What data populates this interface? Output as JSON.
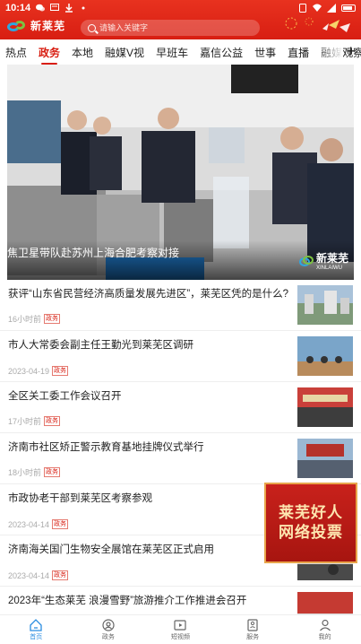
{
  "status_bar": {
    "time": "10:14"
  },
  "header": {
    "logo_text": "新莱芜",
    "search_placeholder": "请输入关键字"
  },
  "tabs": {
    "items": [
      {
        "label": "热点"
      },
      {
        "label": "政务"
      },
      {
        "label": "本地"
      },
      {
        "label": "融媒V视"
      },
      {
        "label": "早班车"
      },
      {
        "label": "嘉信公益"
      },
      {
        "label": "世事"
      },
      {
        "label": "直播"
      },
      {
        "label": "融媒观察"
      }
    ],
    "plus": "+"
  },
  "hero": {
    "title": "焦卫星带队赴苏州上海合肥考察对接",
    "logo_text": "新莱芜",
    "logo_sub": "XINLAIWU"
  },
  "news": [
    {
      "title": "获评“山东省民营经济高质量发展先进区”，莱芜区凭的是什么?",
      "time": "16小时前",
      "tag": "政务"
    },
    {
      "title": "市人大常委会副主任王勤光到莱芜区调研",
      "time": "2023-04-19",
      "tag": "政务"
    },
    {
      "title": "全区关工委工作会议召开",
      "time": "17小时前",
      "tag": "政务"
    },
    {
      "title": "济南市社区矫正警示教育基地挂牌仪式举行",
      "time": "18小时前",
      "tag": "政务"
    },
    {
      "title": "市政协老干部到莱芜区考察参观",
      "time": "2023-04-14",
      "tag": "政务"
    },
    {
      "title": "济南海关国门生物安全展馆在莱芜区正式启用",
      "time": "2023-04-14",
      "tag": "政务"
    },
    {
      "title": "2023年“生态莱芜 浪漫雪野”旅游推介工作推进会召开",
      "time": "",
      "tag": ""
    }
  ],
  "vote_banner": {
    "line1": "莱芜好人",
    "line2": "网络投票"
  },
  "bottom_nav": [
    {
      "label": "首页",
      "icon": "home-icon"
    },
    {
      "label": "政务",
      "icon": "user-icon"
    },
    {
      "label": "短视频",
      "icon": "video-icon"
    },
    {
      "label": "服务",
      "icon": "service-icon"
    },
    {
      "label": "我的",
      "icon": "profile-icon"
    }
  ],
  "colors": {
    "brand_red": "#d81e12",
    "active_blue": "#2b8de0"
  }
}
